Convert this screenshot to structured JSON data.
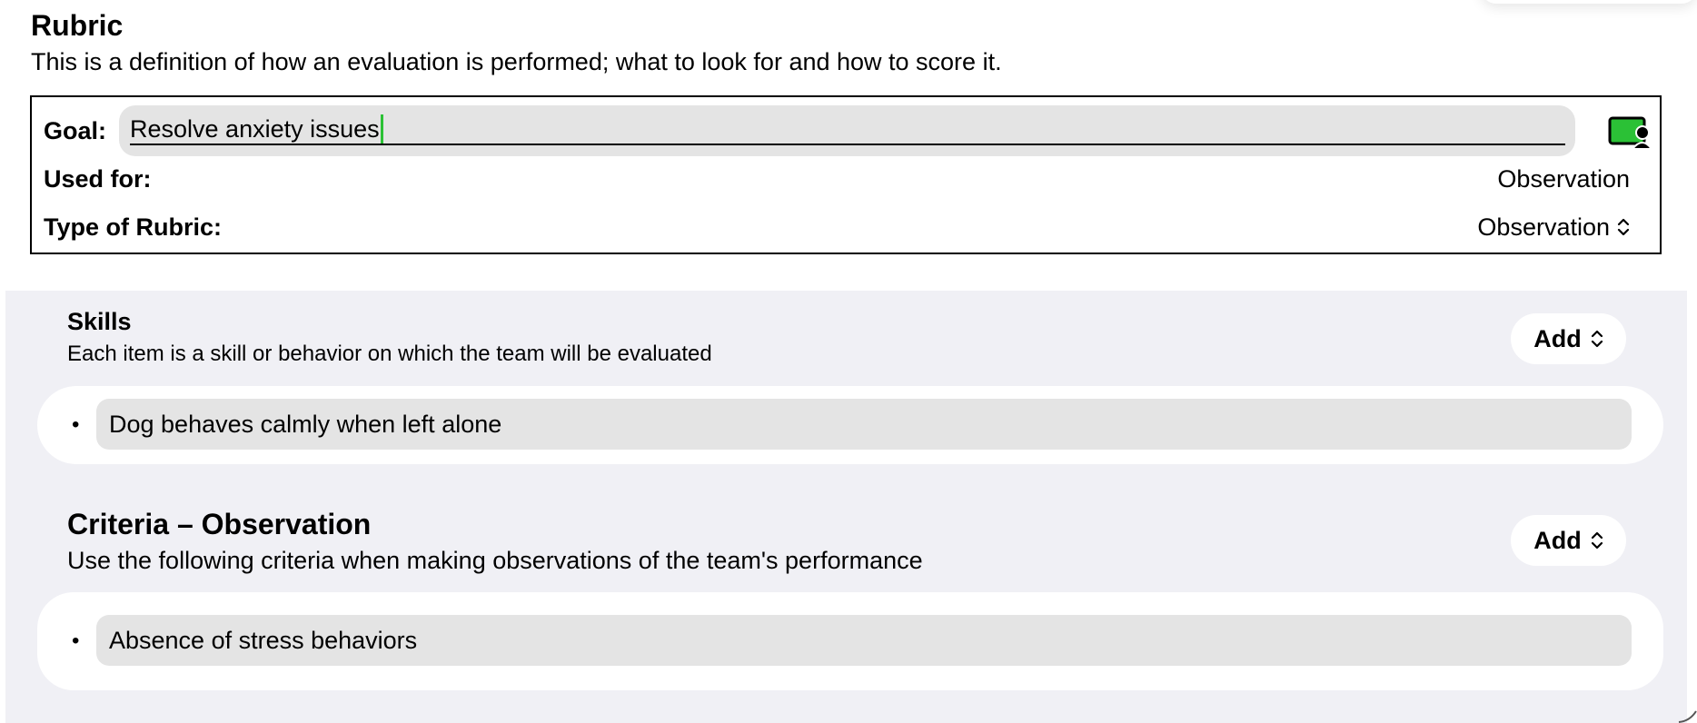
{
  "rubric": {
    "title": "Rubric",
    "description": "This is a definition of how an evaluation is performed; what to look for and how to score it."
  },
  "goal": {
    "label": "Goal:",
    "value": "Resolve anxiety issues",
    "icon": "team-screen-icon",
    "icon_color": "#2bc136"
  },
  "used_for": {
    "label": "Used for:",
    "value": "Observation"
  },
  "type_of_rubric": {
    "label": "Type of Rubric:",
    "value": "Observation"
  },
  "skills": {
    "title": "Skills",
    "description": "Each item is a skill or behavior on which the team will be evaluated",
    "add_label": "Add",
    "items": [
      "Dog behaves calmly when left alone"
    ]
  },
  "criteria": {
    "title": "Criteria – Observation",
    "description": "Use the following criteria when making observations of the team's performance",
    "add_label": "Add",
    "items": [
      "Absence of stress behaviors"
    ]
  },
  "colors": {
    "panel_background": "#f0f0f5",
    "field_background": "#e4e4e4",
    "accent": "#2bc136"
  }
}
